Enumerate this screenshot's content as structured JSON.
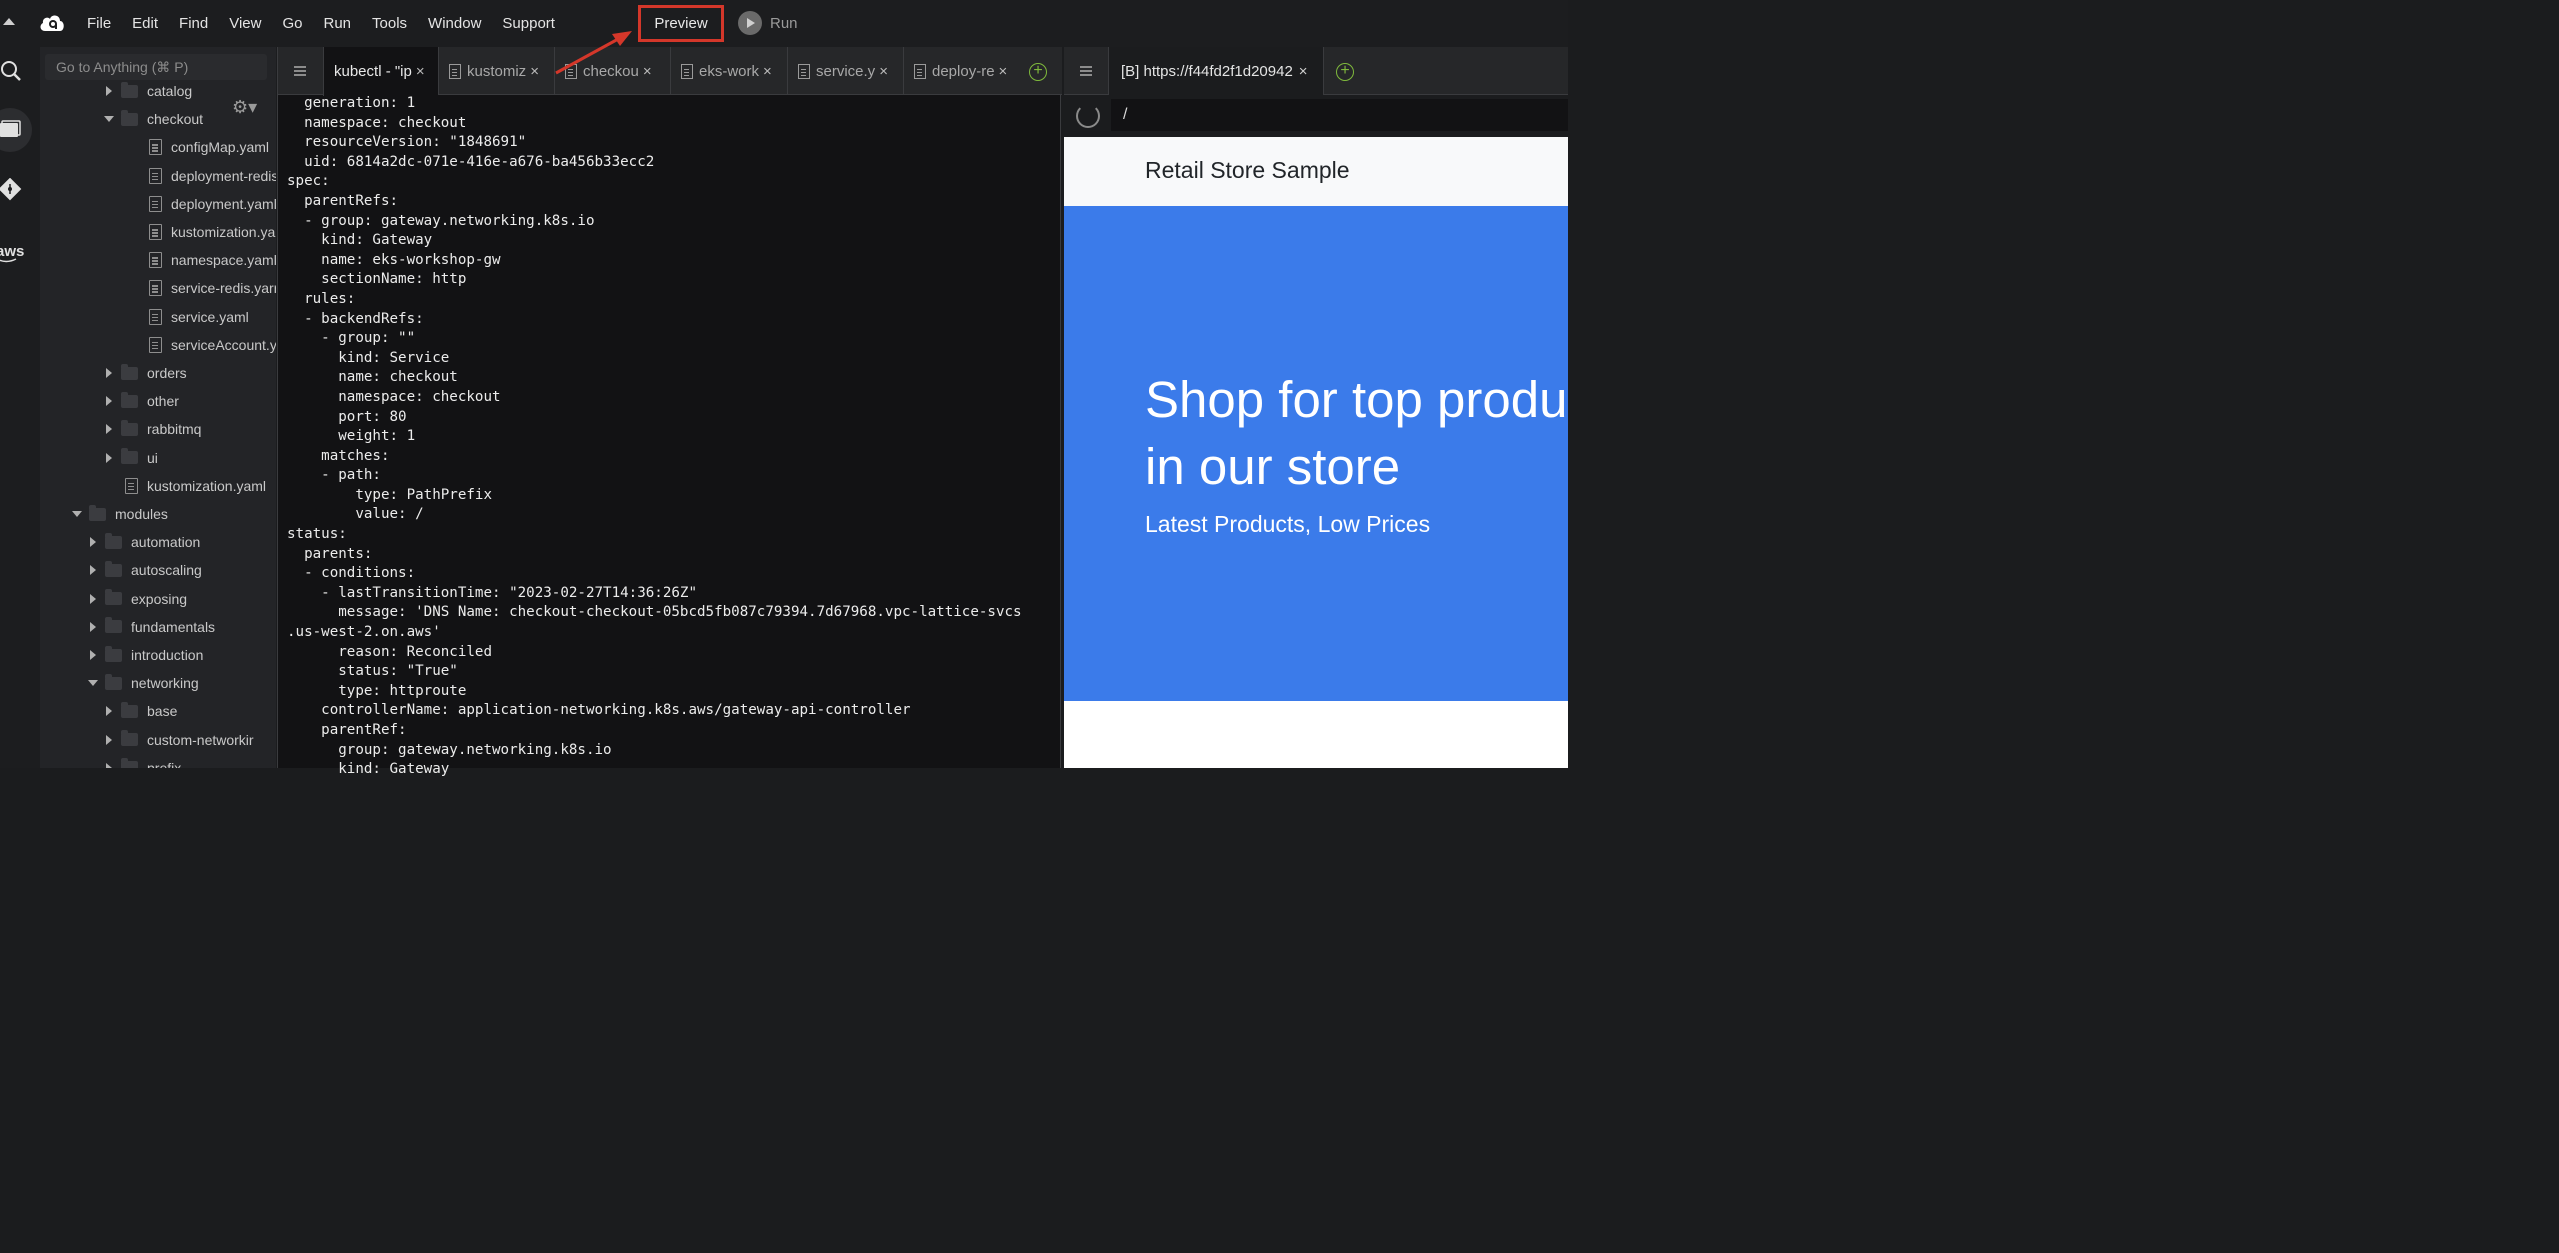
{
  "menubar": {
    "items": [
      "File",
      "Edit",
      "Find",
      "View",
      "Go",
      "Run",
      "Tools",
      "Window",
      "Support"
    ],
    "preview_label": "Preview",
    "run_label": "Run",
    "highlight_color": "#d4372a"
  },
  "rail": {
    "icons": [
      "search-icon",
      "files-icon",
      "git-icon",
      "aws-icon"
    ],
    "aws_label": "aws"
  },
  "tree": {
    "search_placeholder": "Go to Anything (⌘ P)",
    "gear_glyph": "⚙▾",
    "rows": [
      {
        "label": "catalog",
        "type": "folder",
        "state": "collapsed"
      },
      {
        "label": "checkout",
        "type": "folder",
        "state": "expanded"
      },
      {
        "label": "configMap.yaml",
        "type": "file"
      },
      {
        "label": "deployment-redis",
        "type": "file"
      },
      {
        "label": "deployment.yaml",
        "type": "file"
      },
      {
        "label": "kustomization.yar",
        "type": "file"
      },
      {
        "label": "namespace.yaml",
        "type": "file"
      },
      {
        "label": "service-redis.yarr",
        "type": "file"
      },
      {
        "label": "service.yaml",
        "type": "file"
      },
      {
        "label": "serviceAccount.y",
        "type": "file"
      },
      {
        "label": "orders",
        "type": "folder",
        "state": "collapsed"
      },
      {
        "label": "other",
        "type": "folder",
        "state": "collapsed"
      },
      {
        "label": "rabbitmq",
        "type": "folder",
        "state": "collapsed"
      },
      {
        "label": "ui",
        "type": "folder",
        "state": "collapsed"
      },
      {
        "label": "kustomization.yaml",
        "type": "file"
      },
      {
        "label": "modules",
        "type": "folder",
        "state": "expanded"
      },
      {
        "label": "automation",
        "type": "folder",
        "state": "collapsed"
      },
      {
        "label": "autoscaling",
        "type": "folder",
        "state": "collapsed"
      },
      {
        "label": "exposing",
        "type": "folder",
        "state": "collapsed"
      },
      {
        "label": "fundamentals",
        "type": "folder",
        "state": "collapsed"
      },
      {
        "label": "introduction",
        "type": "folder",
        "state": "collapsed"
      },
      {
        "label": "networking",
        "type": "folder",
        "state": "expanded"
      },
      {
        "label": "base",
        "type": "folder",
        "state": "collapsed"
      },
      {
        "label": "custom-networkir",
        "type": "folder",
        "state": "collapsed"
      },
      {
        "label": "prefix",
        "type": "folder",
        "state": "collapsed"
      }
    ]
  },
  "editor": {
    "tabs": [
      {
        "label": "kubectl - \"ip",
        "active": true,
        "close": "×"
      },
      {
        "label": "kustomiz",
        "active": false,
        "close": "×"
      },
      {
        "label": "checkou",
        "active": false,
        "close": "×"
      },
      {
        "label": "eks-work",
        "active": false,
        "close": "×"
      },
      {
        "label": "service.y",
        "active": false,
        "close": "×"
      },
      {
        "label": "deploy-re",
        "active": false,
        "close": "×"
      }
    ],
    "add_tab_glyph": "+",
    "code_lines": [
      "  generation: 1",
      "  namespace: checkout",
      "  resourceVersion: \"1848691\"",
      "  uid: 6814a2dc-071e-416e-a676-ba456b33ecc2",
      "spec:",
      "  parentRefs:",
      "  - group: gateway.networking.k8s.io",
      "    kind: Gateway",
      "    name: eks-workshop-gw",
      "    sectionName: http",
      "  rules:",
      "  - backendRefs:",
      "    - group: \"\"",
      "      kind: Service",
      "      name: checkout",
      "      namespace: checkout",
      "      port: 80",
      "      weight: 1",
      "    matches:",
      "    - path:",
      "        type: PathPrefix",
      "        value: /",
      "status:",
      "  parents:",
      "  - conditions:",
      "    - lastTransitionTime: \"2023-02-27T14:36:26Z\"",
      "      message: 'DNS Name: checkout-checkout-05bcd5fb087c79394.7d67968.vpc-lattice-svcs",
      ".us-west-2.on.aws'",
      "      reason: Reconciled",
      "      status: \"True\"",
      "      type: httproute",
      "    controllerName: application-networking.k8s.aws/gateway-api-controller",
      "    parentRef:",
      "      group: gateway.networking.k8s.io",
      "      kind: Gateway"
    ]
  },
  "browser": {
    "tab_label": "[B] https://f44fd2f1d20942",
    "tab_close": "×",
    "add_tab_glyph": "+",
    "url_value": "/",
    "page": {
      "brand": "Retail Store Sample",
      "hero_title_line1": "Shop for top produ",
      "hero_title_line2": "in our store",
      "hero_subtitle": "Latest Products, Low Prices",
      "hero_color": "#3b7bea"
    }
  }
}
